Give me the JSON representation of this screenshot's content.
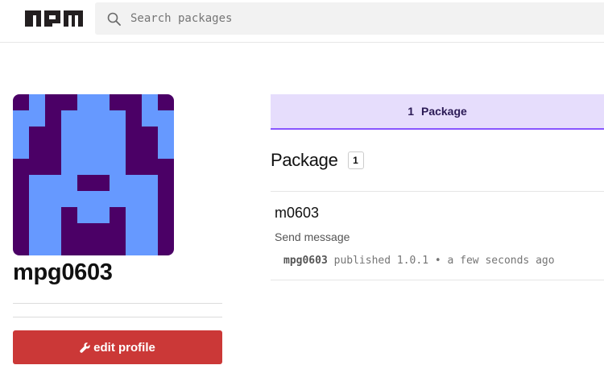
{
  "header": {
    "logo_text": "npm",
    "search_placeholder": "Search packages"
  },
  "profile": {
    "avatar": {
      "background": "#4b0066",
      "foreground": "#6699ff"
    },
    "username": "mpg0603",
    "edit_label": "edit profile"
  },
  "tabs": [
    {
      "count": "1",
      "label": "Package",
      "active": true
    }
  ],
  "packages_section": {
    "title": "Package",
    "count": "1",
    "items": [
      {
        "name": "m0603",
        "description": "Send message",
        "publisher": "mpg0603",
        "published_text": "published 1.0.1 • a few seconds ago"
      }
    ]
  },
  "colors": {
    "brand_red": "#cb3837",
    "tab_bg": "#e6ddfc",
    "tab_accent": "#8956ff"
  }
}
